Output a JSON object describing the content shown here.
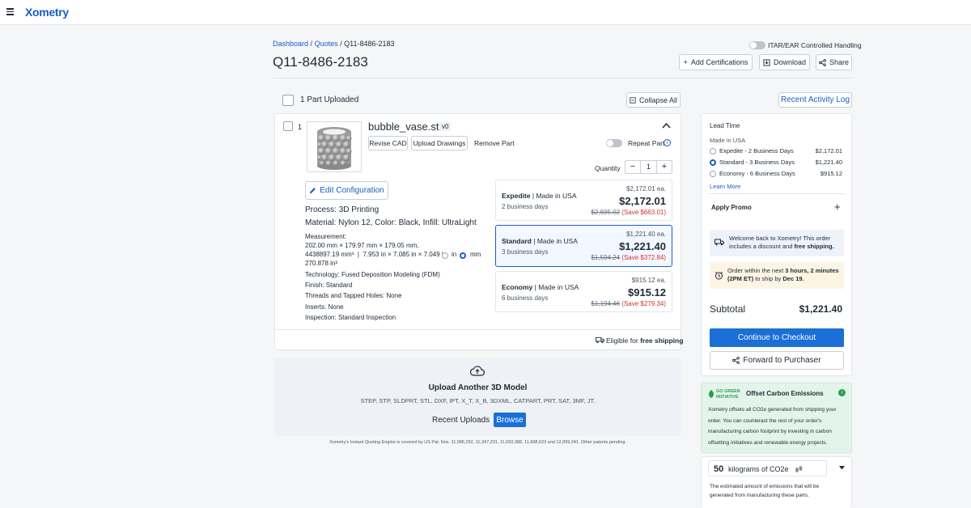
{
  "header": {
    "logo": "Xometry"
  },
  "breadcrumb": {
    "dashboard": "Dashboard",
    "sep1": "/",
    "quotes": "Quotes",
    "sep2": "/",
    "current": "Q11-8486-2183"
  },
  "quote_title": "Q11-8486-2183",
  "itar_label": "ITAR/EAR Controlled Handling",
  "actions": {
    "add_certifications": "Add Certifications",
    "download": "Download",
    "share": "Share"
  },
  "parts_header": {
    "count_label": "1 Part Uploaded",
    "collapse_all": "Collapse All",
    "recent_activity": "Recent Activity Log"
  },
  "part": {
    "index": "1",
    "filename": "bubble_vase.stl",
    "version": "v0",
    "revise_cad": "Revise CAD",
    "upload_drawings": "Upload Drawings",
    "remove_part": "Remove Part",
    "repeat_part": "Repeat Part",
    "quantity_label": "Quantity",
    "quantity": "1",
    "edit_configuration": "Edit Configuration",
    "process_label": "Process:",
    "process_value": "3D Printing",
    "material_label": "Material:",
    "material_value": "Nylon 12, Color: Black, Infill: UltraLight",
    "measurement_label": "Measurement:",
    "measurement_line1": "202.00 mm × 179.97 mm × 179.05 mm,",
    "measurement_line2": "4438897.19 mm³  |  7.953 in × 7.085 in × 7.049 in,",
    "measurement_line3": "270.878 in³",
    "unit_in": "in",
    "unit_mm": "mm",
    "technology_label": "Technology:",
    "technology_value": "Fused Deposition Modeling (FDM)",
    "finish_label": "Finish:",
    "finish_value": "Standard",
    "threads_label": "Threads and Tapped Holes:",
    "threads_value": "None",
    "inserts_label": "Inserts:",
    "inserts_value": "None",
    "inspection_label": "Inspection:",
    "inspection_value": "Standard Inspection",
    "shipping_prefix": "Eligible for",
    "shipping_bold": "free shipping"
  },
  "pricing": [
    {
      "tier": "Expedite",
      "sep": "|",
      "origin": "Made in USA",
      "days": "2 business days",
      "each": "$2,172.01 ea.",
      "total": "$2,172.01",
      "original": "$2,835.02",
      "save": "(Save $663.01)"
    },
    {
      "tier": "Standard",
      "sep": "|",
      "origin": "Made in USA",
      "days": "3 business days",
      "each": "$1,221.40 ea.",
      "total": "$1,221.40",
      "original": "$1,594.24",
      "save": "(Save $372.84)"
    },
    {
      "tier": "Economy",
      "sep": "|",
      "origin": "Made in USA",
      "days": "6 business days",
      "each": "$915.12 ea.",
      "total": "$915.12",
      "original": "$1,194.46",
      "save": "(Save $279.34)"
    }
  ],
  "upload": {
    "title": "Upload Another 3D Model",
    "formats": "STEP, STP, SLDPRT, STL, DXF, IPT, X_T, X_B, 3DXML, CATPART, PRT, SAT, 3MF, JT.",
    "recent_uploads": "Recent Uploads",
    "browse": "Browse"
  },
  "patent_note": "Xometry's Instant Quoting Engine is covered by US Pat. Nos. 11,086,292, 11,347,201, 11,693,388, 11,698,623 and 12,099,341. Other patents pending.",
  "sidebar": {
    "lead_time_title": "Lead Time",
    "made_in": "Made in USA",
    "options": [
      {
        "label": "Expedite - 2 Business Days",
        "price": "$2,172.01",
        "selected": false
      },
      {
        "label": "Standard - 3 Business Days",
        "price": "$1,221.40",
        "selected": true
      },
      {
        "label": "Economy - 6 Business Days",
        "price": "$915.12",
        "selected": false
      }
    ],
    "learn_more": "Learn More",
    "apply_promo": "Apply Promo",
    "promo_plus": "+",
    "welcome_text": "Welcome back to Xometry! This order includes a discount and",
    "welcome_bold": "free shipping.",
    "order_prefix": "Order within the next",
    "order_bold_time": "3 hours, 2 minutes (2PM ET)",
    "order_mid": "to ship by",
    "order_bold_date": "Dec 19.",
    "subtotal_label": "Subtotal",
    "subtotal_value": "$1,221.40",
    "checkout": "Continue to Checkout",
    "forward": "Forward to Purchaser",
    "go_green_line1": "GO GREEN",
    "go_green_line2": "INITIATIVE",
    "offset_title": "Offset Carbon Emissions",
    "offset_text": "Xometry offsets all CO2e generated from shipping your order. You can counteract the rest of your order's manufacturing carbon footprint by investing in carbon offsetting initiatives and renewable energy projects.",
    "co2_amount": "50",
    "co2_unit": "kilograms of CO2e",
    "co2_note": "The estimated amount of emissions that will be generated from manufacturing these parts."
  },
  "colors": {
    "accent": "#1b5cc4",
    "primary_button": "#1b6fd6",
    "save_red": "#d0342c",
    "green_panel": "#e3f4ea",
    "notice_yellow": "#fdf5e3"
  }
}
